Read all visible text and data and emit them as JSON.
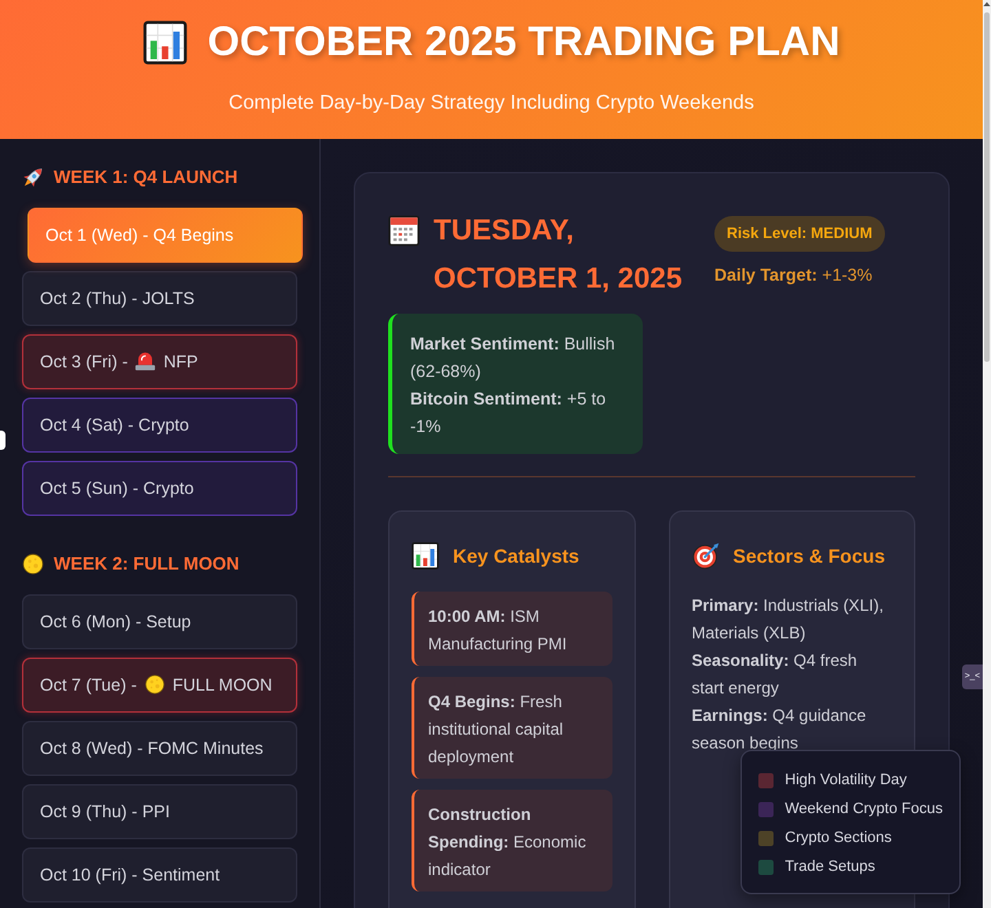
{
  "header": {
    "title": "OCTOBER 2025 TRADING PLAN",
    "subtitle": "Complete Day-by-Day Strategy Including Crypto Weekends"
  },
  "sidebar": {
    "weeks": [
      {
        "title": "WEEK 1: Q4 LAUNCH",
        "kind": "launch",
        "days": [
          {
            "label": "Oct 1 (Wed) - Q4 Begins",
            "kind": "normal",
            "selected": true
          },
          {
            "label": "Oct 2 (Thu) - JOLTS",
            "kind": "normal",
            "selected": false
          },
          {
            "label": "Oct 3 (Fri) -",
            "suffix": "NFP",
            "kind": "alert",
            "selected": false
          },
          {
            "label": "Oct 4 (Sat) - Crypto",
            "kind": "crypto",
            "selected": false
          },
          {
            "label": "Oct 5 (Sun) - Crypto",
            "kind": "crypto",
            "selected": false
          }
        ]
      },
      {
        "title": "WEEK 2: FULL MOON",
        "kind": "full-moon",
        "days": [
          {
            "label": "Oct 6 (Mon) - Setup",
            "kind": "normal",
            "selected": false
          },
          {
            "label": "Oct 7 (Tue) -",
            "suffix": "FULL MOON",
            "kind": "full-moon",
            "selected": false
          },
          {
            "label": "Oct 8 (Wed) - FOMC Minutes",
            "kind": "normal",
            "selected": false
          },
          {
            "label": "Oct 9 (Thu) - PPI",
            "kind": "normal",
            "selected": false
          },
          {
            "label": "Oct 10 (Fri) - Sentiment",
            "kind": "normal",
            "selected": false
          }
        ]
      }
    ]
  },
  "day_view": {
    "title": "TUESDAY, OCTOBER 1, 2025",
    "risk_badge": "Risk Level: MEDIUM",
    "daily_target": "**Daily Target:** +1-3%",
    "sentiment": [
      "**Market Sentiment:** Bullish (62-68%)",
      "**Bitcoin Sentiment:** +5 to -1%"
    ],
    "sections": [
      {
        "title": "Key Catalysts",
        "kind": "catalysts",
        "items": [
          "**10:00 AM:** ISM Manufacturing PMI",
          "**Q4 Begins:** Fresh institutional capital deployment",
          "**Construction Spending:** Economic indicator"
        ]
      },
      {
        "title": "Sectors & Focus",
        "kind": "sectors",
        "items": [
          "**Primary:** Industrials (XLI), Materials (XLB)",
          "**Seasonality:** Q4 fresh start energy",
          "**Earnings:** Q4 guidance season begins"
        ]
      }
    ]
  },
  "legend": [
    {
      "label": "High Volatility Day",
      "color": "#5a2632"
    },
    {
      "label": "Weekend Crypto Focus",
      "color": "#3b2557"
    },
    {
      "label": "Crypto Sections",
      "color": "#4d4227"
    },
    {
      "label": "Trade Setups",
      "color": "#1d4a40"
    }
  ],
  "widget": {
    "label": ">_<"
  }
}
